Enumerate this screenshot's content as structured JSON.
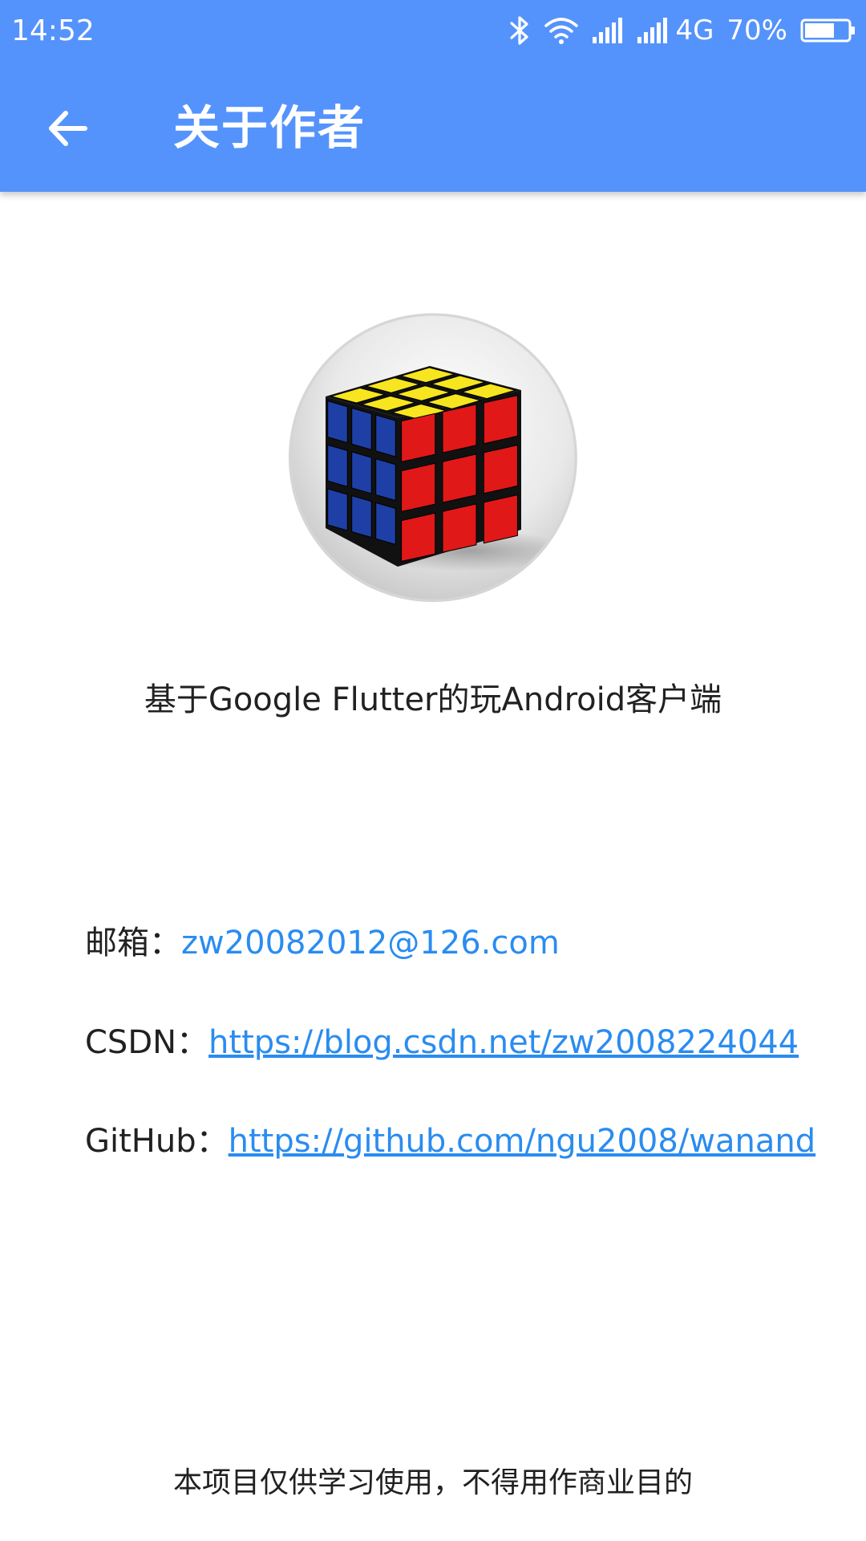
{
  "status_bar": {
    "time": "14:52",
    "network_label": "4G",
    "battery_label": "70%",
    "icons": [
      "bluetooth-icon",
      "wifi-icon",
      "signal-icon",
      "signal-icon",
      "battery-icon"
    ],
    "battery_level": 0.7
  },
  "toolbar": {
    "back_icon": "arrow-back-icon",
    "title": "关于作者"
  },
  "colors": {
    "app_bar": "#5593fc",
    "link": "#2a8cf0",
    "text": "#212121",
    "background": "#ffffff"
  },
  "main": {
    "subtitle": "基于Google Flutter的玩Android客户端",
    "contacts": [
      {
        "label": "邮箱：",
        "value": "zw20082012@126.com"
      },
      {
        "label": "CSDN：",
        "value": "https://blog.csdn.net/zw2008224044"
      },
      {
        "label": "GitHub：",
        "value": "https://github.com/ngu2008/wanand"
      }
    ],
    "footer": "本项目仅供学习使用，不得用作商业目的"
  }
}
